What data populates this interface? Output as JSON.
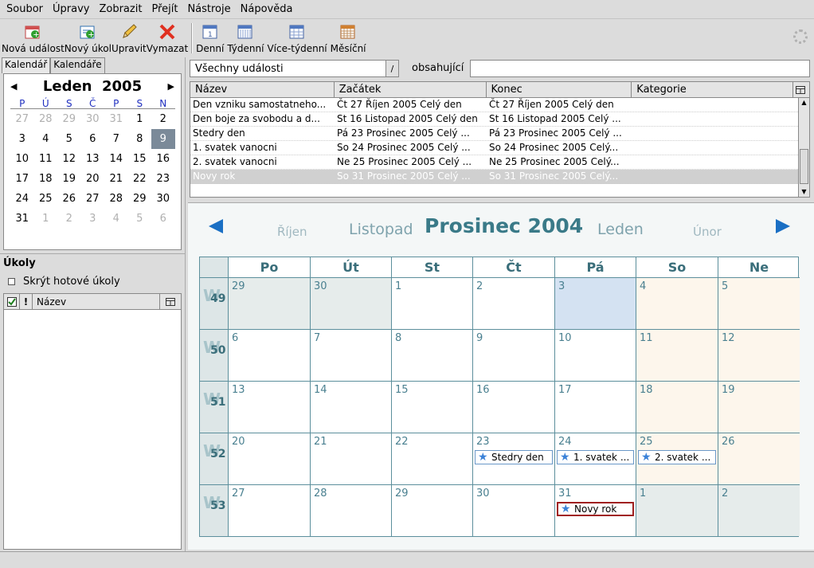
{
  "menu": [
    "Soubor",
    "Úpravy",
    "Zobrazit",
    "Přejít",
    "Nástroje",
    "Nápověda"
  ],
  "toolbar": {
    "new_event": "Nová událost",
    "new_task": "Nový úkol",
    "edit": "Upravit",
    "delete": "Vymazat",
    "day": "Denní",
    "week": "Týdenní",
    "multiweek": "Více-týdenní",
    "month": "Měsíční"
  },
  "left": {
    "tab_calendar": "Kalendář",
    "tab_calendars": "Kalendáře",
    "mini_title": "Leden  2005",
    "weekday_heads": [
      "P",
      "Ú",
      "S",
      "Č",
      "P",
      "S",
      "N"
    ],
    "days": [
      [
        "27",
        "28",
        "29",
        "30",
        "31",
        "1",
        "2"
      ],
      [
        "3",
        "4",
        "5",
        "6",
        "7",
        "8",
        "9"
      ],
      [
        "10",
        "11",
        "12",
        "13",
        "14",
        "15",
        "16"
      ],
      [
        "17",
        "18",
        "19",
        "20",
        "21",
        "22",
        "23"
      ],
      [
        "24",
        "25",
        "26",
        "27",
        "28",
        "29",
        "30"
      ],
      [
        "31",
        "1",
        "2",
        "3",
        "4",
        "5",
        "6"
      ]
    ],
    "tasks_title": "Úkoly",
    "hide_done": "Skrýt hotové úkoly",
    "task_col_name": "Název"
  },
  "filter": {
    "selected": "Všechny události",
    "containing_label": "obsahující",
    "search_value": ""
  },
  "event_table": {
    "columns": [
      "Název",
      "Začátek",
      "Konec",
      "Kategorie"
    ],
    "rows": [
      [
        "Den vzniku samostatneho...",
        "Čt 27 Říjen 2005 Celý den",
        "Čt 27 Říjen 2005 Celý den",
        ""
      ],
      [
        "Den boje za svobodu a d...",
        "St 16 Listopad 2005 Celý den",
        "St 16 Listopad 2005 Celý ...",
        ""
      ],
      [
        "Stedry den",
        "Pá 23 Prosinec 2005 Celý ...",
        "Pá 23 Prosinec 2005 Celý ...",
        ""
      ],
      [
        "1. svatek vanocni",
        "So 24 Prosinec 2005 Celý ...",
        "So 24 Prosinec 2005 Celý...",
        ""
      ],
      [
        "2. svatek vanocni",
        "Ne 25 Prosinec 2005 Celý ...",
        "Ne 25 Prosinec 2005 Celý...",
        ""
      ],
      [
        "Novy rok",
        "So 31 Prosinec 2005 Celý ...",
        "So 31 Prosinec 2005 Celý...",
        ""
      ]
    ],
    "selected_row": 5
  },
  "month_view": {
    "prev2": "Říjen",
    "prev1": "Listopad",
    "current": "Prosinec 2004",
    "next1": "Leden",
    "next2": "Únor",
    "day_heads": [
      "Po",
      "Út",
      "St",
      "Čt",
      "Pá",
      "So",
      "Ne"
    ],
    "week_letter": "W",
    "weeks": [
      {
        "n": "49",
        "days": [
          "29",
          "30",
          "1",
          "2",
          "3",
          "4",
          "5"
        ]
      },
      {
        "n": "50",
        "days": [
          "6",
          "7",
          "8",
          "9",
          "10",
          "11",
          "12"
        ]
      },
      {
        "n": "51",
        "days": [
          "13",
          "14",
          "15",
          "16",
          "17",
          "18",
          "19"
        ]
      },
      {
        "n": "52",
        "days": [
          "20",
          "21",
          "22",
          "23",
          "24",
          "25",
          "26"
        ]
      },
      {
        "n": "53",
        "days": [
          "27",
          "28",
          "29",
          "30",
          "31",
          "1",
          "2"
        ]
      }
    ],
    "events": [
      {
        "week": 3,
        "day": 3,
        "label": "Stedry den",
        "selected": false
      },
      {
        "week": 3,
        "day": 4,
        "label": "1. svatek ...",
        "selected": false
      },
      {
        "week": 3,
        "day": 5,
        "label": "2. svatek ...",
        "selected": false
      },
      {
        "week": 4,
        "day": 4,
        "label": "Novy rok",
        "selected": true
      }
    ]
  }
}
